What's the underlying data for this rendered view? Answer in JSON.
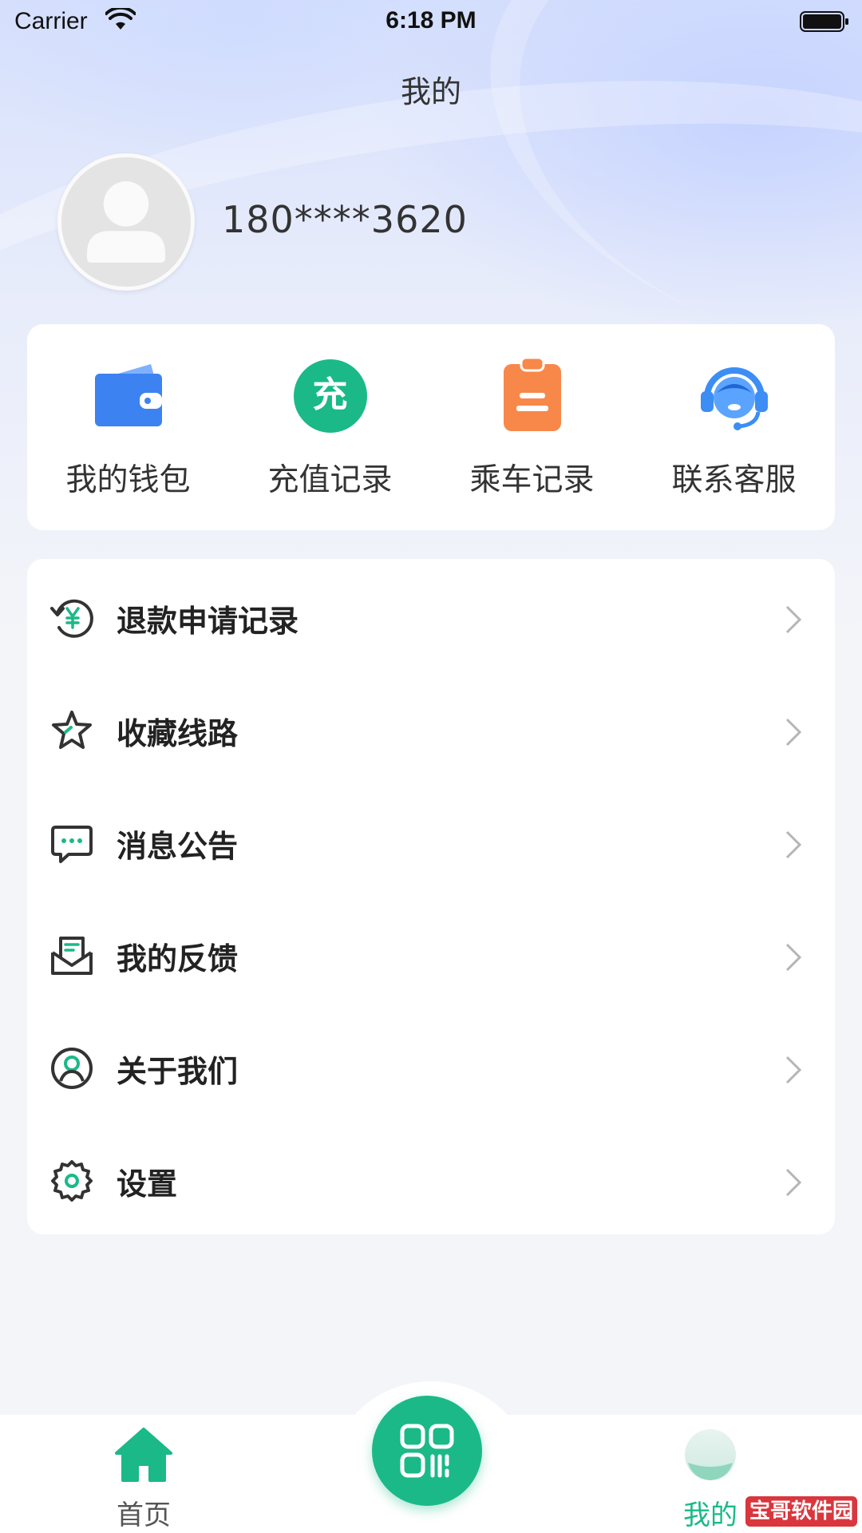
{
  "status_bar": {
    "carrier": "Carrier",
    "time": "6:18 PM"
  },
  "header": {
    "title": "我的"
  },
  "profile": {
    "phone": "180****3620"
  },
  "quick_actions": [
    {
      "label": "我的钱包",
      "icon": "wallet-icon"
    },
    {
      "label": "充值记录",
      "icon": "recharge-icon",
      "badge": "充"
    },
    {
      "label": "乘车记录",
      "icon": "clipboard-icon"
    },
    {
      "label": "联系客服",
      "icon": "headset-icon"
    }
  ],
  "menu": [
    {
      "label": "退款申请记录",
      "icon": "refund-icon"
    },
    {
      "label": "收藏线路",
      "icon": "star-icon"
    },
    {
      "label": "消息公告",
      "icon": "message-icon"
    },
    {
      "label": "我的反馈",
      "icon": "mail-icon"
    },
    {
      "label": "关于我们",
      "icon": "user-circle-icon"
    },
    {
      "label": "设置",
      "icon": "gear-icon"
    }
  ],
  "tabbar": {
    "home_label": "首页",
    "mine_label": "我的",
    "active": "mine"
  },
  "watermark": "宝哥软件园",
  "colors": {
    "accent": "#1bb988",
    "wallet": "#3c82f0",
    "ride": "#f7884a",
    "service": "#3c8ef5"
  }
}
